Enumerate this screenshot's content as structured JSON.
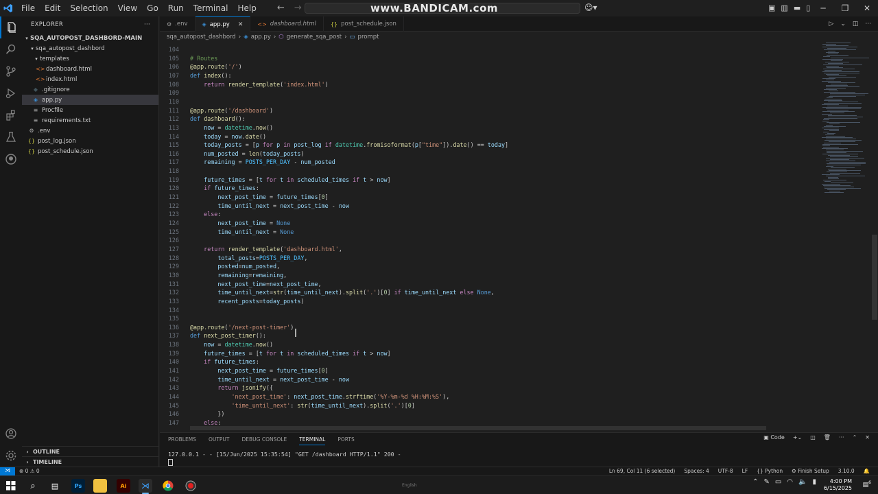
{
  "titlebar": {
    "menu": [
      "File",
      "Edit",
      "Selection",
      "View",
      "Go",
      "Run",
      "Terminal",
      "Help"
    ],
    "watermark": "www.BANDICAM.com"
  },
  "explorer": {
    "title": "EXPLORER",
    "root": "SQA_AUTOPOST_DASHBORD-MAIN",
    "items": [
      {
        "label": "sqa_autopost_dashbord",
        "type": "folder"
      },
      {
        "label": "templates",
        "type": "folder"
      },
      {
        "label": "dashboard.html",
        "type": "html"
      },
      {
        "label": "index.html",
        "type": "html"
      },
      {
        "label": ".gitignore",
        "type": "git"
      },
      {
        "label": "app.py",
        "type": "py"
      },
      {
        "label": "Procfile",
        "type": "file"
      },
      {
        "label": "requirements.txt",
        "type": "txt"
      },
      {
        "label": ".env",
        "type": "env"
      },
      {
        "label": "post_log.json",
        "type": "json"
      },
      {
        "label": "post_schedule.json",
        "type": "json"
      }
    ],
    "outline": "OUTLINE",
    "timeline": "TIMELINE"
  },
  "tabs": [
    {
      "label": ".env",
      "active": false
    },
    {
      "label": "app.py",
      "active": true
    },
    {
      "label": "dashboard.html",
      "active": false
    },
    {
      "label": "post_schedule.json",
      "active": false
    }
  ],
  "breadcrumb": [
    "sqa_autopost_dashbord",
    "app.py",
    "generate_sqa_post",
    "prompt"
  ],
  "editor": {
    "lines": [
      {
        "n": "104",
        "t": ""
      },
      {
        "n": "105",
        "t": "# Routes"
      },
      {
        "n": "106",
        "t": "@app.route('/')"
      },
      {
        "n": "107",
        "t": "def index():"
      },
      {
        "n": "108",
        "t": "    return render_template('index.html')"
      },
      {
        "n": "109",
        "t": ""
      },
      {
        "n": "110",
        "t": ""
      },
      {
        "n": "111",
        "t": "@app.route('/dashboard')"
      },
      {
        "n": "112",
        "t": "def dashboard():"
      },
      {
        "n": "113",
        "t": "    now = datetime.now()"
      },
      {
        "n": "114",
        "t": "    today = now.date()"
      },
      {
        "n": "115",
        "t": "    today_posts = [p for p in post_log if datetime.fromisoformat(p[\"time\"]).date() == today]"
      },
      {
        "n": "116",
        "t": "    num_posted = len(today_posts)"
      },
      {
        "n": "117",
        "t": "    remaining = POSTS_PER_DAY - num_posted"
      },
      {
        "n": "118",
        "t": ""
      },
      {
        "n": "119",
        "t": "    future_times = [t for t in scheduled_times if t > now]"
      },
      {
        "n": "120",
        "t": "    if future_times:"
      },
      {
        "n": "121",
        "t": "        next_post_time = future_times[0]"
      },
      {
        "n": "122",
        "t": "        time_until_next = next_post_time - now"
      },
      {
        "n": "123",
        "t": "    else:"
      },
      {
        "n": "124",
        "t": "        next_post_time = None"
      },
      {
        "n": "125",
        "t": "        time_until_next = None"
      },
      {
        "n": "126",
        "t": ""
      },
      {
        "n": "127",
        "t": "    return render_template('dashboard.html',"
      },
      {
        "n": "128",
        "t": "        total_posts=POSTS_PER_DAY,"
      },
      {
        "n": "129",
        "t": "        posted=num_posted,"
      },
      {
        "n": "130",
        "t": "        remaining=remaining,"
      },
      {
        "n": "131",
        "t": "        next_post_time=next_post_time,"
      },
      {
        "n": "132",
        "t": "        time_until_next=str(time_until_next).split('.')[0] if time_until_next else None,"
      },
      {
        "n": "133",
        "t": "        recent_posts=today_posts)"
      },
      {
        "n": "134",
        "t": ""
      },
      {
        "n": "135",
        "t": ""
      },
      {
        "n": "136",
        "t": "@app.route('/next-post-timer')"
      },
      {
        "n": "137",
        "t": "def next_post_timer():"
      },
      {
        "n": "138",
        "t": "    now = datetime.now()"
      },
      {
        "n": "139",
        "t": "    future_times = [t for t in scheduled_times if t > now]"
      },
      {
        "n": "140",
        "t": "    if future_times:"
      },
      {
        "n": "141",
        "t": "        next_post_time = future_times[0]"
      },
      {
        "n": "142",
        "t": "        time_until_next = next_post_time - now"
      },
      {
        "n": "143",
        "t": "        return jsonify({"
      },
      {
        "n": "144",
        "t": "            'next_post_time': next_post_time.strftime('%Y-%m-%d %H:%M:%S'),"
      },
      {
        "n": "145",
        "t": "            'time_until_next': str(time_until_next).split('.')[0]"
      },
      {
        "n": "146",
        "t": "        })"
      },
      {
        "n": "147",
        "t": "    else:"
      }
    ]
  },
  "panel": {
    "tabs": [
      "PROBLEMS",
      "OUTPUT",
      "DEBUG CONSOLE",
      "TERMINAL",
      "PORTS"
    ],
    "active_tab": "TERMINAL",
    "terminal_label": "Code",
    "terminal_lines": [
      "127.0.0.1 - - [15/Jun/2025 15:35:54] \"GET /dashboard HTTP/1.1\" 200 -"
    ]
  },
  "statusbar": {
    "problems": "⊗ 0 ⚠ 0",
    "position": "Ln 69, Col 11 (6 selected)",
    "spaces": "Spaces: 4",
    "encoding": "UTF-8",
    "eol": "LF",
    "language": "Python",
    "finish_setup": "Finish Setup",
    "python_version": "3.10.0"
  },
  "taskbar": {
    "time": "4:00 PM",
    "date": "6/15/2025",
    "language": "English",
    "notifications": "6"
  },
  "colors": {
    "accent": "#0078d4",
    "editor_bg": "#1f1f1f",
    "sidebar_bg": "#181818"
  }
}
